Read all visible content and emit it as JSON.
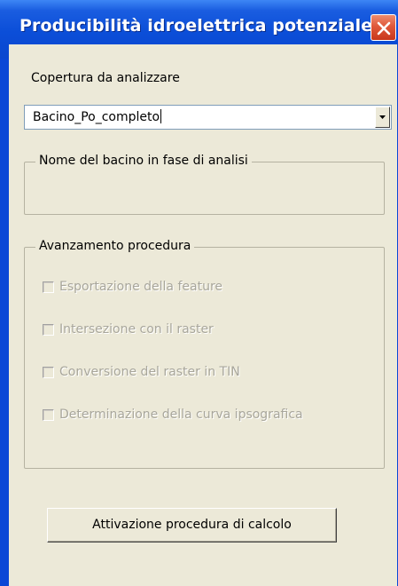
{
  "window": {
    "title": "Producibilità idroelettrica potenziale",
    "close_icon": "close-icon"
  },
  "coverage": {
    "label": "Copertura da analizzare",
    "selected_value": "Bacino_Po_completo"
  },
  "basin_group": {
    "legend": "Nome del bacino in fase di analisi",
    "value": ""
  },
  "progress_group": {
    "legend": "Avanzamento procedura",
    "steps": [
      {
        "label": "Esportazione della feature",
        "checked": false,
        "enabled": false
      },
      {
        "label": "Intersezione con il raster",
        "checked": false,
        "enabled": false
      },
      {
        "label": "Conversione del raster in TIN",
        "checked": false,
        "enabled": false
      },
      {
        "label": "Determinazione della curva ipsografica",
        "checked": false,
        "enabled": false
      }
    ]
  },
  "actions": {
    "run_label": "Attivazione procedura di calcolo"
  },
  "colors": {
    "titlebar": "#0a47d6",
    "client_background": "#ece9d8",
    "close_button": "#e0583a",
    "disabled_text": "#a8a69b"
  }
}
